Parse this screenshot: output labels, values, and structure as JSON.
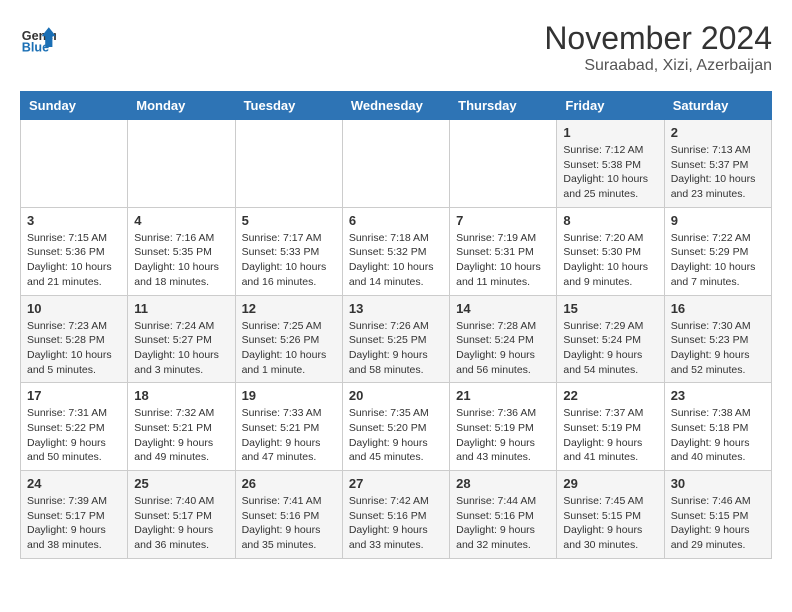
{
  "header": {
    "logo_text_general": "General",
    "logo_text_blue": "Blue",
    "month_year": "November 2024",
    "location": "Suraabad, Xizi, Azerbaijan"
  },
  "calendar": {
    "days_of_week": [
      "Sunday",
      "Monday",
      "Tuesday",
      "Wednesday",
      "Thursday",
      "Friday",
      "Saturday"
    ],
    "weeks": [
      [
        {
          "day": "",
          "info": ""
        },
        {
          "day": "",
          "info": ""
        },
        {
          "day": "",
          "info": ""
        },
        {
          "day": "",
          "info": ""
        },
        {
          "day": "",
          "info": ""
        },
        {
          "day": "1",
          "info": "Sunrise: 7:12 AM\nSunset: 5:38 PM\nDaylight: 10 hours and 25 minutes."
        },
        {
          "day": "2",
          "info": "Sunrise: 7:13 AM\nSunset: 5:37 PM\nDaylight: 10 hours and 23 minutes."
        }
      ],
      [
        {
          "day": "3",
          "info": "Sunrise: 7:15 AM\nSunset: 5:36 PM\nDaylight: 10 hours and 21 minutes."
        },
        {
          "day": "4",
          "info": "Sunrise: 7:16 AM\nSunset: 5:35 PM\nDaylight: 10 hours and 18 minutes."
        },
        {
          "day": "5",
          "info": "Sunrise: 7:17 AM\nSunset: 5:33 PM\nDaylight: 10 hours and 16 minutes."
        },
        {
          "day": "6",
          "info": "Sunrise: 7:18 AM\nSunset: 5:32 PM\nDaylight: 10 hours and 14 minutes."
        },
        {
          "day": "7",
          "info": "Sunrise: 7:19 AM\nSunset: 5:31 PM\nDaylight: 10 hours and 11 minutes."
        },
        {
          "day": "8",
          "info": "Sunrise: 7:20 AM\nSunset: 5:30 PM\nDaylight: 10 hours and 9 minutes."
        },
        {
          "day": "9",
          "info": "Sunrise: 7:22 AM\nSunset: 5:29 PM\nDaylight: 10 hours and 7 minutes."
        }
      ],
      [
        {
          "day": "10",
          "info": "Sunrise: 7:23 AM\nSunset: 5:28 PM\nDaylight: 10 hours and 5 minutes."
        },
        {
          "day": "11",
          "info": "Sunrise: 7:24 AM\nSunset: 5:27 PM\nDaylight: 10 hours and 3 minutes."
        },
        {
          "day": "12",
          "info": "Sunrise: 7:25 AM\nSunset: 5:26 PM\nDaylight: 10 hours and 1 minute."
        },
        {
          "day": "13",
          "info": "Sunrise: 7:26 AM\nSunset: 5:25 PM\nDaylight: 9 hours and 58 minutes."
        },
        {
          "day": "14",
          "info": "Sunrise: 7:28 AM\nSunset: 5:24 PM\nDaylight: 9 hours and 56 minutes."
        },
        {
          "day": "15",
          "info": "Sunrise: 7:29 AM\nSunset: 5:24 PM\nDaylight: 9 hours and 54 minutes."
        },
        {
          "day": "16",
          "info": "Sunrise: 7:30 AM\nSunset: 5:23 PM\nDaylight: 9 hours and 52 minutes."
        }
      ],
      [
        {
          "day": "17",
          "info": "Sunrise: 7:31 AM\nSunset: 5:22 PM\nDaylight: 9 hours and 50 minutes."
        },
        {
          "day": "18",
          "info": "Sunrise: 7:32 AM\nSunset: 5:21 PM\nDaylight: 9 hours and 49 minutes."
        },
        {
          "day": "19",
          "info": "Sunrise: 7:33 AM\nSunset: 5:21 PM\nDaylight: 9 hours and 47 minutes."
        },
        {
          "day": "20",
          "info": "Sunrise: 7:35 AM\nSunset: 5:20 PM\nDaylight: 9 hours and 45 minutes."
        },
        {
          "day": "21",
          "info": "Sunrise: 7:36 AM\nSunset: 5:19 PM\nDaylight: 9 hours and 43 minutes."
        },
        {
          "day": "22",
          "info": "Sunrise: 7:37 AM\nSunset: 5:19 PM\nDaylight: 9 hours and 41 minutes."
        },
        {
          "day": "23",
          "info": "Sunrise: 7:38 AM\nSunset: 5:18 PM\nDaylight: 9 hours and 40 minutes."
        }
      ],
      [
        {
          "day": "24",
          "info": "Sunrise: 7:39 AM\nSunset: 5:17 PM\nDaylight: 9 hours and 38 minutes."
        },
        {
          "day": "25",
          "info": "Sunrise: 7:40 AM\nSunset: 5:17 PM\nDaylight: 9 hours and 36 minutes."
        },
        {
          "day": "26",
          "info": "Sunrise: 7:41 AM\nSunset: 5:16 PM\nDaylight: 9 hours and 35 minutes."
        },
        {
          "day": "27",
          "info": "Sunrise: 7:42 AM\nSunset: 5:16 PM\nDaylight: 9 hours and 33 minutes."
        },
        {
          "day": "28",
          "info": "Sunrise: 7:44 AM\nSunset: 5:16 PM\nDaylight: 9 hours and 32 minutes."
        },
        {
          "day": "29",
          "info": "Sunrise: 7:45 AM\nSunset: 5:15 PM\nDaylight: 9 hours and 30 minutes."
        },
        {
          "day": "30",
          "info": "Sunrise: 7:46 AM\nSunset: 5:15 PM\nDaylight: 9 hours and 29 minutes."
        }
      ]
    ]
  }
}
